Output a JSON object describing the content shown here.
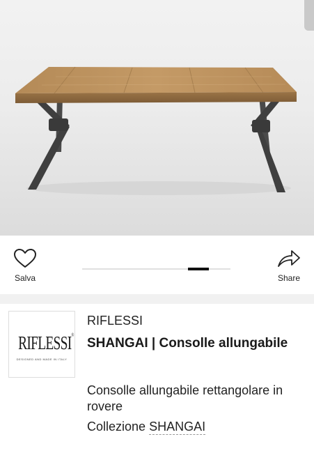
{
  "actions": {
    "save_label": "Salva",
    "share_label": "Share"
  },
  "gallery": {
    "image_count": 5,
    "active_index": 4
  },
  "brand": {
    "logo_text": "RIFLESSI",
    "logo_tagline": "DESIGNED AND MADE IN ITALY",
    "name": "RIFLESSI"
  },
  "product": {
    "title": "SHANGAI | Consolle allungabile",
    "description": "Consolle allungabile rettangolare in rovere",
    "collection_prefix": "Collezione",
    "collection_name": "SHANGAI"
  }
}
